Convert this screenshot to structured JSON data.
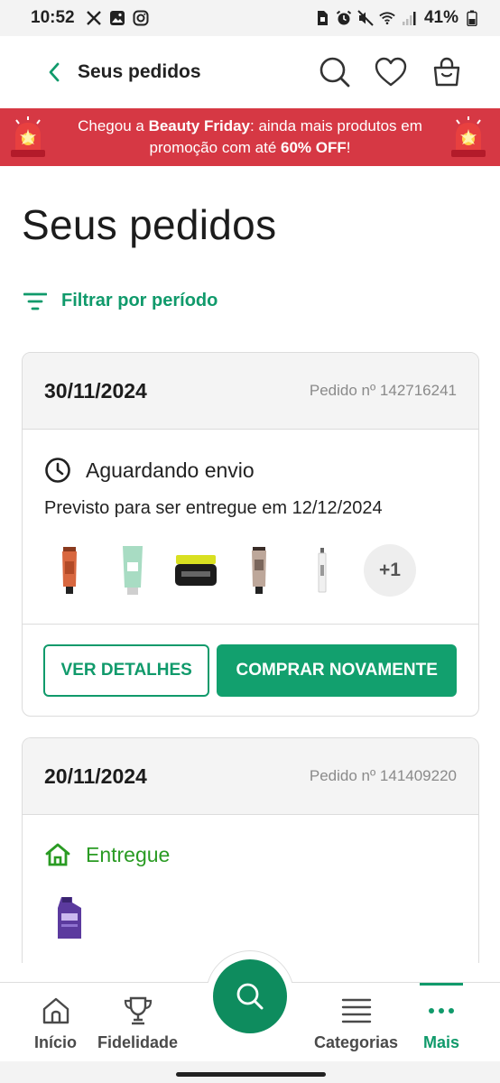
{
  "status_bar": {
    "time": "10:52",
    "battery": "41%"
  },
  "header": {
    "title": "Seus pedidos"
  },
  "promo": {
    "text_before": "Chegou a ",
    "highlight_event": "Beauty Friday",
    "text_middle": ": ainda mais produtos em promoção com até ",
    "highlight_discount": "60% OFF",
    "text_after": "!"
  },
  "page": {
    "title": "Seus pedidos",
    "filter_label": "Filtrar por período"
  },
  "orders": [
    {
      "date": "30/11/2024",
      "order_number": "Pedido nº 142716241",
      "status": "Aguardando envio",
      "forecast": "Previsto para ser entregue em 12/12/2024",
      "more_items": "+1",
      "details_label": "VER DETALHES",
      "rebuy_label": "COMPRAR NOVAMENTE"
    },
    {
      "date": "20/11/2024",
      "order_number": "Pedido nº 141409220",
      "status": "Entregue"
    }
  ],
  "bottom_nav": {
    "items": [
      {
        "label": "Início",
        "icon": "home-icon"
      },
      {
        "label": "Fidelidade",
        "icon": "trophy-icon"
      },
      {
        "label": "Categorias",
        "icon": "list-icon"
      },
      {
        "label": "Mais",
        "icon": "more-dots-icon"
      }
    ],
    "active": "Mais"
  },
  "colors": {
    "brand_green": "#109a6b",
    "promo_red": "#d63844",
    "delivered_green": "#2a9b23"
  }
}
